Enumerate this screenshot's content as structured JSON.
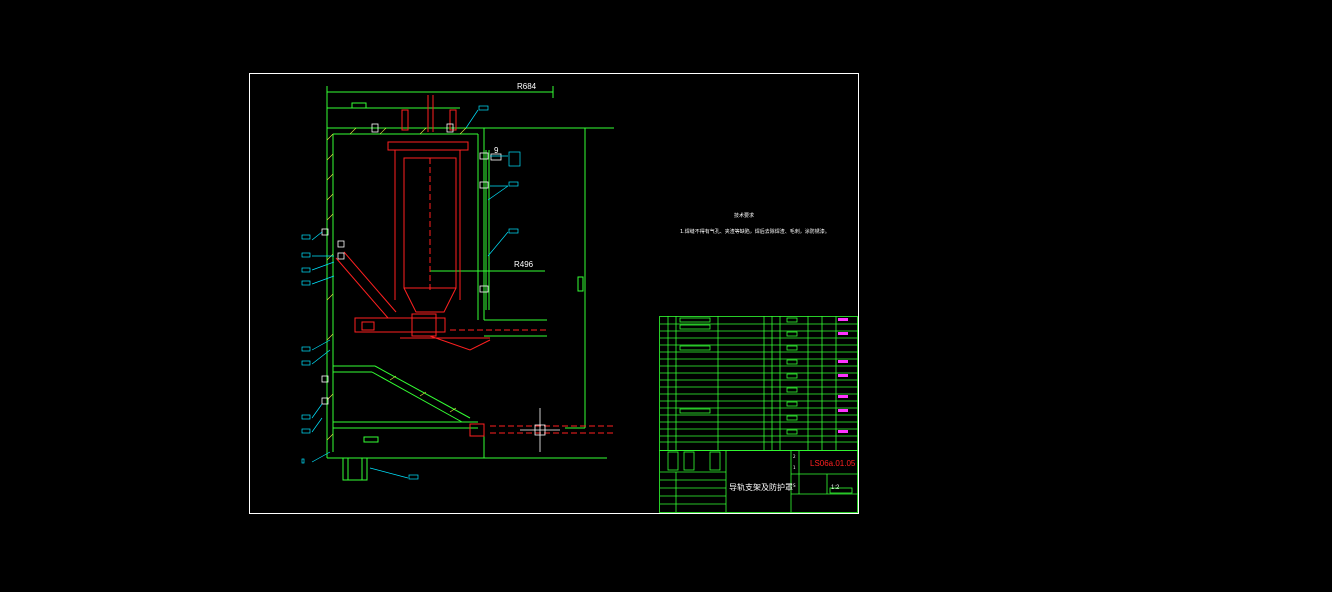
{
  "drawing": {
    "dimensions": {
      "top_radius": "R684",
      "inner_radius": "R496",
      "small_dim": "9"
    },
    "notes": {
      "heading": "技术要求",
      "line1": "1.焊缝不得有气孔、夹渣等缺陷，焊后去除焊渣、毛刺，涂防锈漆。"
    },
    "title_block": {
      "part_name": "导轨支架及防护罩",
      "drawing_code": "LS06a.01.05",
      "scale": "1:2",
      "sheet_marks": [
        "2",
        "1"
      ],
      "stamp": "S"
    },
    "colors": {
      "frame": "#ffffff",
      "structure": "#33ff33",
      "mechanism": "#ff2020",
      "leader": "#00e5ff",
      "code": "#ff2020",
      "table_accent": "#ff33ff"
    }
  }
}
